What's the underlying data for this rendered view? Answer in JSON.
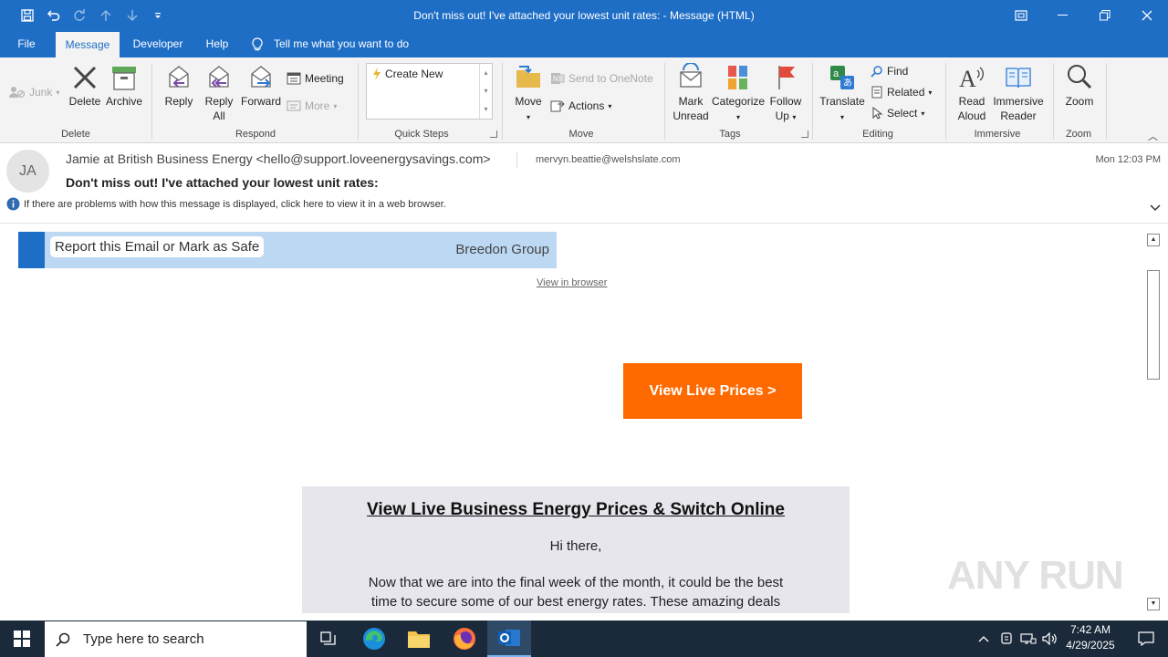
{
  "window": {
    "title": "Don't miss out! I've attached your lowest unit rates:  -  Message (HTML)"
  },
  "tabs": [
    "File",
    "Message",
    "Developer",
    "Help"
  ],
  "tell_me": "Tell me what you want to do",
  "ribbon": {
    "junk": "Junk",
    "delete": "Delete",
    "archive": "Archive",
    "reply": "Reply",
    "reply_all_1": "Reply",
    "reply_all_2": "All",
    "forward": "Forward",
    "meeting": "Meeting",
    "more": "More",
    "quick_steps_item": "Create New",
    "move": "Move",
    "send_to_onenote": "Send to OneNote",
    "actions": "Actions",
    "mark_unread_1": "Mark",
    "mark_unread_2": "Unread",
    "categorize": "Categorize",
    "follow_up_1": "Follow",
    "follow_up_2": "Up",
    "translate": "Translate",
    "find": "Find",
    "related": "Related",
    "select": "Select",
    "read_aloud_1": "Read",
    "read_aloud_2": "Aloud",
    "immersive_reader_1": "Immersive",
    "immersive_reader_2": "Reader",
    "zoom": "Zoom",
    "groups": {
      "delete": "Delete",
      "respond": "Respond",
      "quick_steps": "Quick Steps",
      "move": "Move",
      "tags": "Tags",
      "editing": "Editing",
      "immersive": "Immersive",
      "zoom": "Zoom"
    }
  },
  "message": {
    "avatar_initials": "JA",
    "from": "Jamie at British Business Energy <hello@support.loveenergysavings.com>",
    "to": "mervyn.beattie@welshslate.com",
    "date": "Mon 12:03 PM",
    "subject": "Don't miss out! I've attached your lowest unit rates:",
    "info_bar": "If there are problems with how this message is displayed, click here to view it in a web browser."
  },
  "email_body": {
    "report_button": "Report this Email or Mark as Safe",
    "org_name": "Breedon Group",
    "view_in_browser": "View in browser",
    "cta_button": "View Live Prices >",
    "heading": "View Live Business Energy Prices & Switch Online",
    "greeting": "Hi there,",
    "paragraph_line1": "Now that we are into the final week of the month, it could be the best",
    "paragraph_line2": "time to secure some of our best energy rates. These amazing  deals"
  },
  "watermark": "ANY RUN",
  "taskbar": {
    "search_placeholder": "Type here to search",
    "time": "7:42 AM",
    "date": "4/29/2025"
  },
  "colors": {
    "accent": "#1f6ec6",
    "cta": "#ff6a00",
    "report_bar": "#bcd8f2",
    "report_stripe": "#1f6ec6",
    "content_box": "#e7e6ed",
    "taskbar": "#1b2a3a"
  }
}
